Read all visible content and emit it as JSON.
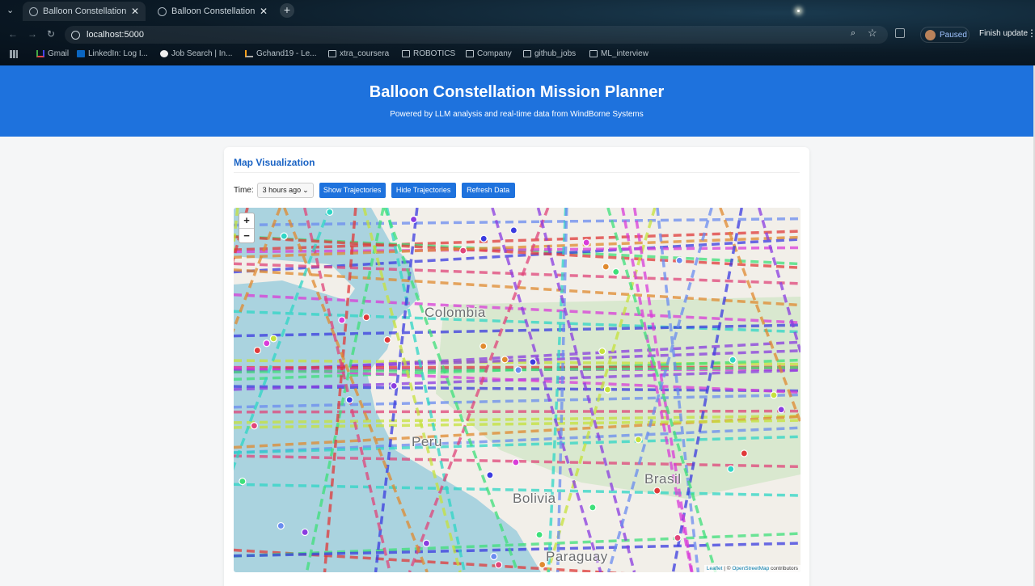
{
  "browser": {
    "tabs": [
      {
        "title": "Balloon Constellation Mi",
        "active": false
      },
      {
        "title": "Balloon Constellation Mi",
        "active": true
      }
    ],
    "url": "localhost:5000",
    "profile_status": "Paused",
    "update_label": "Finish update",
    "bookmarks": [
      "Gmail",
      "LinkedIn: Log I...",
      "Job Search | In...",
      "Gchand19 - Le...",
      "xtra_coursera",
      "ROBOTICS",
      "Company",
      "github_jobs",
      "ML_interview"
    ]
  },
  "header": {
    "title": "Balloon Constellation Mission Planner",
    "subtitle": "Powered by LLM analysis and real-time data from WindBorne Systems"
  },
  "panel": {
    "title": "Map Visualization",
    "time_label": "Time:",
    "time_selected": "3 hours ago",
    "buttons": {
      "show": "Show Trajectories",
      "hide": "Hide Trajectories",
      "refresh": "Refresh Data"
    }
  },
  "map": {
    "labels": {
      "colombia": "Colombia",
      "peru": "Peru",
      "brasil": "Brasil",
      "bolivia": "Bolivia",
      "paraguay": "Paraguay"
    },
    "zoom_in": "+",
    "zoom_out": "−",
    "attribution_leaflet": "Leaflet",
    "attribution_sep": " | © ",
    "attribution_osm": "OpenStreetMap",
    "attribution_tail": " contributors",
    "trajectory_colors": [
      "#3b3be0",
      "#e03a3a",
      "#d93cd9",
      "#3ee07a",
      "#c6e23c",
      "#2fd6c6",
      "#e08a2f",
      "#8a3ce0",
      "#6a8cf0",
      "#e0457a"
    ]
  }
}
